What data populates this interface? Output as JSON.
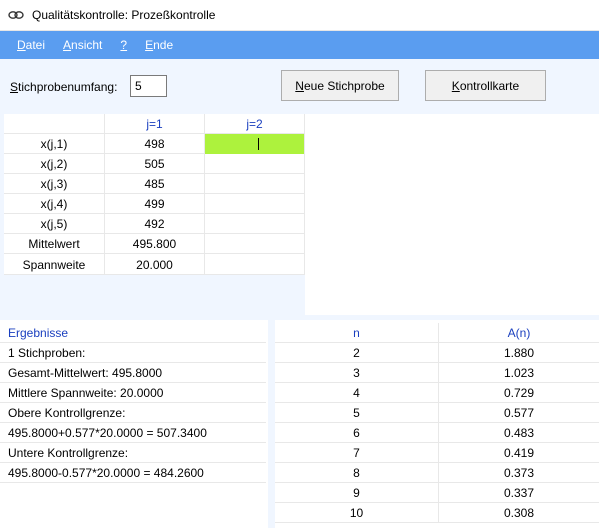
{
  "window": {
    "title": "Qualitätskontrolle: Prozeßkontrolle",
    "icon": "app-chain-icon"
  },
  "menu": [
    {
      "mnemonic": "D",
      "rest": "atei"
    },
    {
      "mnemonic": "A",
      "rest": "nsicht"
    },
    {
      "mnemonic": "?",
      "rest": ""
    },
    {
      "mnemonic": "E",
      "rest": "nde"
    }
  ],
  "controls": {
    "sample_label_mn": "S",
    "sample_label_rest": "tichprobenumfang:",
    "sample_value": "5",
    "new_sample_mn": "N",
    "new_sample_rest": "eue Stichprobe",
    "chart_mn": "K",
    "chart_rest": "ontrollkarte"
  },
  "grid": {
    "headers": [
      "",
      "j=1",
      "j=2"
    ],
    "rows": [
      {
        "label": "x(j,1)",
        "v1": "498",
        "v2": ""
      },
      {
        "label": "x(j,2)",
        "v1": "505",
        "v2": ""
      },
      {
        "label": "x(j,3)",
        "v1": "485",
        "v2": ""
      },
      {
        "label": "x(j,4)",
        "v1": "499",
        "v2": ""
      },
      {
        "label": "x(j,5)",
        "v1": "492",
        "v2": ""
      },
      {
        "label": "Mittelwert",
        "v1": "495.800",
        "v2": ""
      },
      {
        "label": "Spannweite",
        "v1": "20.000",
        "v2": ""
      }
    ]
  },
  "results": {
    "title": "Ergebnisse",
    "lines": [
      " 1 Stichproben:",
      "Gesamt-Mittelwert: 495.8000",
      "Mittlere Spannweite: 20.0000",
      "Obere Kontrollgrenze:",
      "495.8000+0.577*20.0000 = 507.3400",
      "Untere Kontrollgrenze:",
      "495.8000-0.577*20.0000 = 484.2600"
    ]
  },
  "factors": {
    "headers": [
      "n",
      "A(n)"
    ],
    "rows": [
      {
        "n": "2",
        "a": "1.880"
      },
      {
        "n": "3",
        "a": "1.023"
      },
      {
        "n": "4",
        "a": "0.729"
      },
      {
        "n": "5",
        "a": "0.577"
      },
      {
        "n": "6",
        "a": "0.483"
      },
      {
        "n": "7",
        "a": "0.419"
      },
      {
        "n": "8",
        "a": "0.373"
      },
      {
        "n": "9",
        "a": "0.337"
      },
      {
        "n": "10",
        "a": "0.308"
      }
    ]
  },
  "colors": {
    "menu_bg": "#5a9df0",
    "header_text": "#1a3fbf",
    "active_cell": "#adf23d",
    "app_bg": "#f0f6ff"
  }
}
